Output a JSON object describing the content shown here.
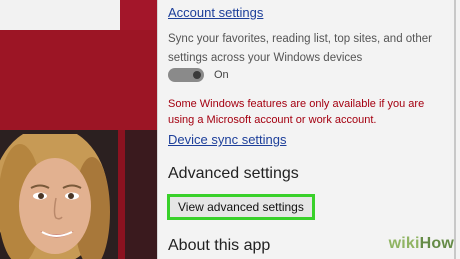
{
  "settings_pane": {
    "account_settings_link": "Account settings",
    "sync_description": "Sync your favorites, reading list, top sites, and other settings across your Windows devices",
    "sync_toggle": {
      "state_label": "On",
      "is_on": true
    },
    "warning_text": "Some Windows features are only available if you are using a Microsoft account or work account.",
    "device_sync_link": "Device sync settings",
    "advanced_heading": "Advanced settings",
    "view_advanced_button": "View advanced settings",
    "about_heading": "About this app"
  },
  "watermark": {
    "part1": "wiki",
    "part2": "How"
  },
  "colors": {
    "link": "#1d3f9a",
    "warning": "#a40010",
    "highlight": "#39d12a",
    "background_left": "#8c1220"
  }
}
